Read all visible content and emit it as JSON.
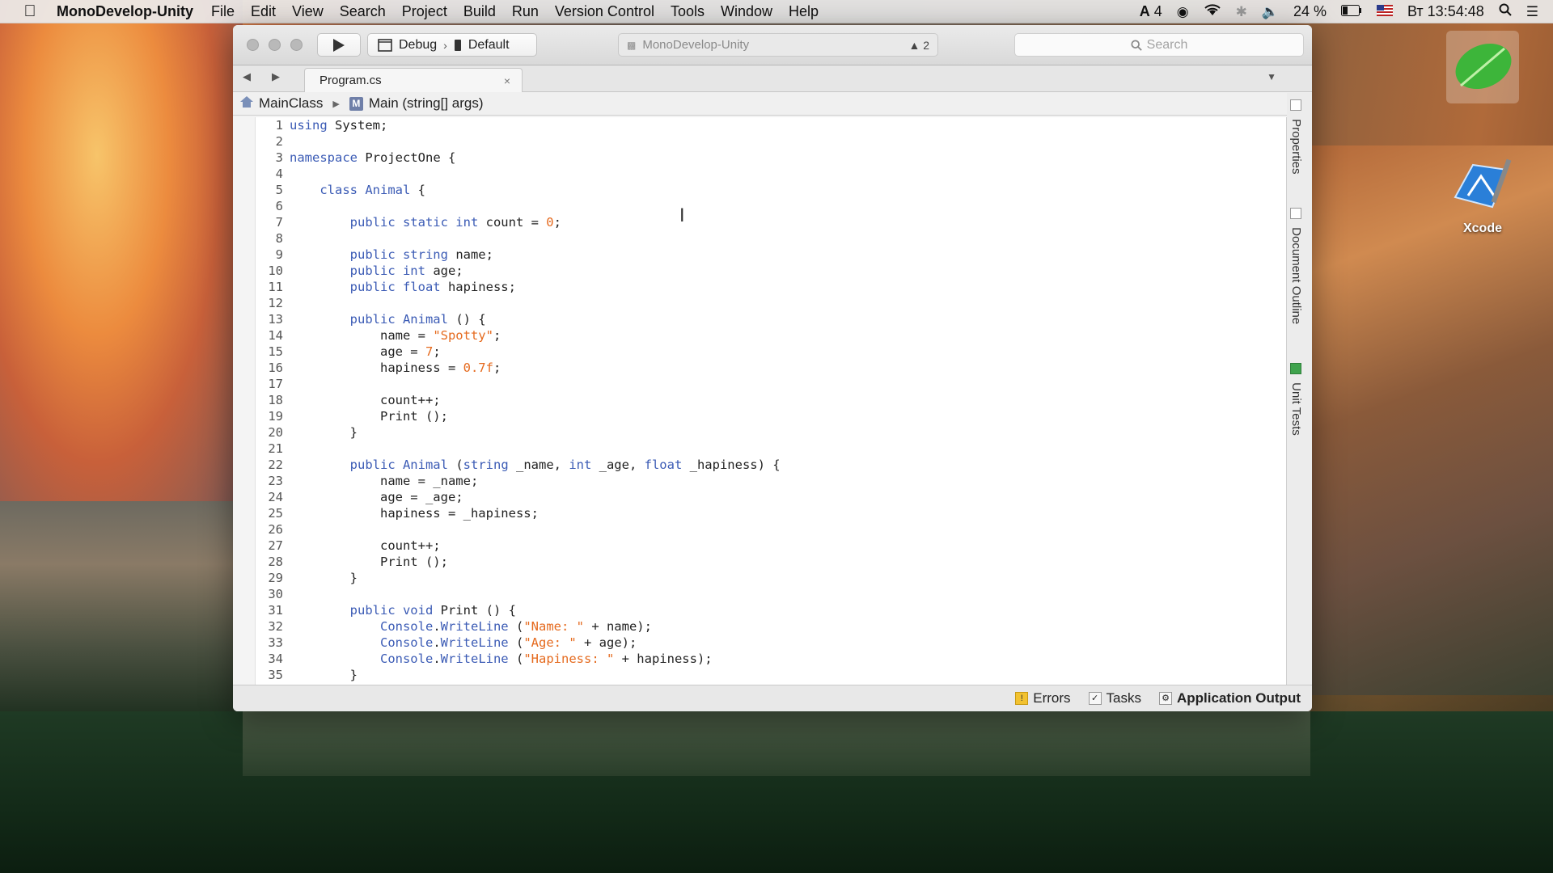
{
  "menubar": {
    "app_name": "MonoDevelop-Unity",
    "items": [
      "File",
      "Edit",
      "View",
      "Search",
      "Project",
      "Build",
      "Run",
      "Version Control",
      "Tools",
      "Window",
      "Help"
    ],
    "status": {
      "notif_count": "4",
      "battery": "24 %",
      "clock": "Вт 13:54:48"
    }
  },
  "desktop": {
    "xcode_label": "Xcode"
  },
  "toolbar": {
    "config": "Debug",
    "target": "Default",
    "window_title": "MonoDevelop-Unity",
    "warning_count": "2",
    "search_placeholder": "Search"
  },
  "tab": {
    "filename": "Program.cs",
    "close": "×"
  },
  "breadcrumb": {
    "class_name": "MainClass",
    "method_icon": "M",
    "method": "Main (string[] args)"
  },
  "side_tabs": {
    "properties": "Properties",
    "outline": "Document Outline",
    "tests": "Unit Tests"
  },
  "statusbar": {
    "errors": "Errors",
    "tasks": "Tasks",
    "output": "Application Output"
  },
  "code_lines": [
    [
      [
        "kw",
        "using"
      ],
      [
        "txt",
        " System;"
      ]
    ],
    [],
    [
      [
        "kw",
        "namespace"
      ],
      [
        "txt",
        " ProjectOne {"
      ]
    ],
    [],
    [
      [
        "txt",
        "    "
      ],
      [
        "kw",
        "class"
      ],
      [
        "txt",
        " "
      ],
      [
        "kw",
        "Animal"
      ],
      [
        "txt",
        " {"
      ]
    ],
    [],
    [
      [
        "txt",
        "        "
      ],
      [
        "kw",
        "public static int"
      ],
      [
        "txt",
        " count = "
      ],
      [
        "num",
        "0"
      ],
      [
        "txt",
        ";"
      ]
    ],
    [],
    [
      [
        "txt",
        "        "
      ],
      [
        "kw",
        "public string"
      ],
      [
        "txt",
        " name;"
      ]
    ],
    [
      [
        "txt",
        "        "
      ],
      [
        "kw",
        "public int"
      ],
      [
        "txt",
        " age;"
      ]
    ],
    [
      [
        "txt",
        "        "
      ],
      [
        "kw",
        "public float"
      ],
      [
        "txt",
        " hapiness;"
      ]
    ],
    [],
    [
      [
        "txt",
        "        "
      ],
      [
        "kw",
        "public Animal"
      ],
      [
        "txt",
        " () {"
      ]
    ],
    [
      [
        "txt",
        "            name = "
      ],
      [
        "str",
        "\"Spotty\""
      ],
      [
        "txt",
        ";"
      ]
    ],
    [
      [
        "txt",
        "            age = "
      ],
      [
        "num",
        "7"
      ],
      [
        "txt",
        ";"
      ]
    ],
    [
      [
        "txt",
        "            hapiness = "
      ],
      [
        "num",
        "0.7f"
      ],
      [
        "txt",
        ";"
      ]
    ],
    [],
    [
      [
        "txt",
        "            count++;"
      ]
    ],
    [
      [
        "txt",
        "            Print ();"
      ]
    ],
    [
      [
        "txt",
        "        }"
      ]
    ],
    [],
    [
      [
        "txt",
        "        "
      ],
      [
        "kw",
        "public Animal"
      ],
      [
        "txt",
        " ("
      ],
      [
        "kw",
        "string"
      ],
      [
        "txt",
        " _name, "
      ],
      [
        "kw",
        "int"
      ],
      [
        "txt",
        " _age, "
      ],
      [
        "kw",
        "float"
      ],
      [
        "txt",
        " _hapiness) {"
      ]
    ],
    [
      [
        "txt",
        "            name = _name;"
      ]
    ],
    [
      [
        "txt",
        "            age = _age;"
      ]
    ],
    [
      [
        "txt",
        "            hapiness = _hapiness;"
      ]
    ],
    [],
    [
      [
        "txt",
        "            count++;"
      ]
    ],
    [
      [
        "txt",
        "            Print ();"
      ]
    ],
    [
      [
        "txt",
        "        }"
      ]
    ],
    [],
    [
      [
        "txt",
        "        "
      ],
      [
        "kw",
        "public void"
      ],
      [
        "txt",
        " Print () {"
      ]
    ],
    [
      [
        "txt",
        "            "
      ],
      [
        "kw",
        "Console"
      ],
      [
        "txt",
        "."
      ],
      [
        "kw",
        "WriteLine"
      ],
      [
        "txt",
        " ("
      ],
      [
        "str",
        "\"Name: \""
      ],
      [
        "txt",
        " + name);"
      ]
    ],
    [
      [
        "txt",
        "            "
      ],
      [
        "kw",
        "Console"
      ],
      [
        "txt",
        "."
      ],
      [
        "kw",
        "WriteLine"
      ],
      [
        "txt",
        " ("
      ],
      [
        "str",
        "\"Age: \""
      ],
      [
        "txt",
        " + age);"
      ]
    ],
    [
      [
        "txt",
        "            "
      ],
      [
        "kw",
        "Console"
      ],
      [
        "txt",
        "."
      ],
      [
        "kw",
        "WriteLine"
      ],
      [
        "txt",
        " ("
      ],
      [
        "str",
        "\"Hapiness: \""
      ],
      [
        "txt",
        " + hapiness);"
      ]
    ],
    [
      [
        "txt",
        "        }"
      ]
    ]
  ],
  "colors": {
    "keyword": "#3b5bb5",
    "string": "#e56a1e",
    "number": "#e56a1e"
  },
  "icons": [
    "apple-icon",
    "play-icon",
    "search-icon",
    "warning-icon",
    "close-icon",
    "class-icon",
    "method-icon",
    "leaf-icon",
    "xcode-icon",
    "wifi-icon",
    "volume-icon",
    "battery-icon",
    "flag-icon",
    "list-icon",
    "spotlight-icon"
  ]
}
